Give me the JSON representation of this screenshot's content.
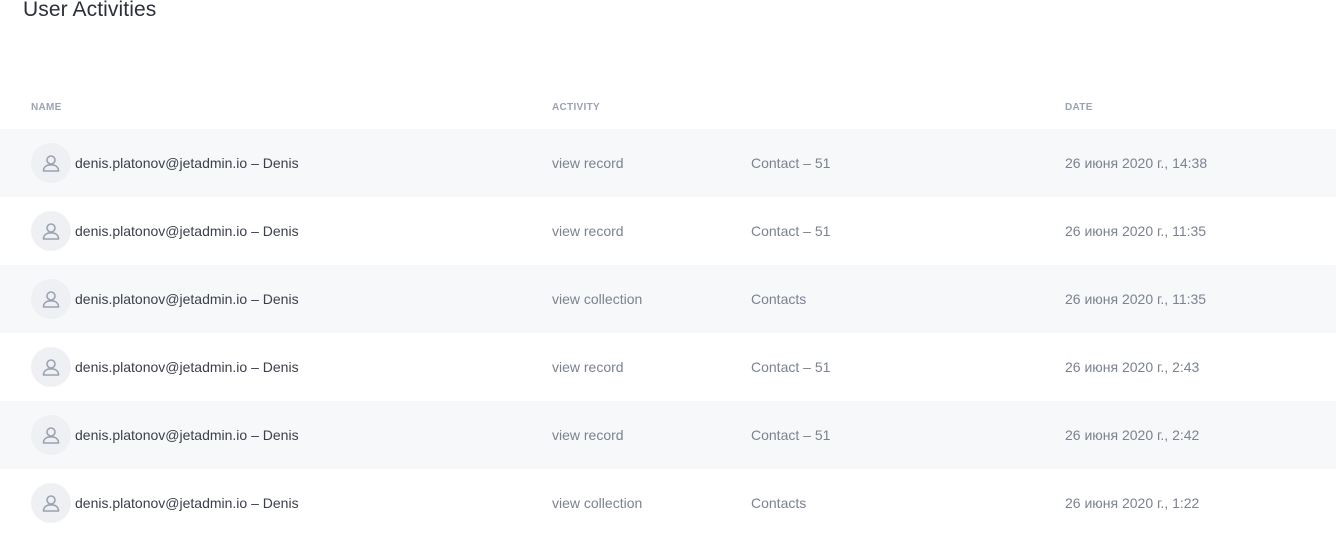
{
  "page": {
    "title": "User Activities"
  },
  "table": {
    "headers": {
      "name": "NAME",
      "activity": "ACTIVITY",
      "date": "DATE"
    },
    "rows": [
      {
        "user": "denis.platonov@jetadmin.io – Denis",
        "activity": "view record",
        "object": "Contact – 51",
        "date": "26 июня 2020 г., 14:38"
      },
      {
        "user": "denis.platonov@jetadmin.io – Denis",
        "activity": "view record",
        "object": "Contact – 51",
        "date": "26 июня 2020 г., 11:35"
      },
      {
        "user": "denis.platonov@jetadmin.io – Denis",
        "activity": "view collection",
        "object": "Contacts",
        "date": "26 июня 2020 г., 11:35"
      },
      {
        "user": "denis.platonov@jetadmin.io – Denis",
        "activity": "view record",
        "object": "Contact – 51",
        "date": "26 июня 2020 г., 2:43"
      },
      {
        "user": "denis.platonov@jetadmin.io – Denis",
        "activity": "view record",
        "object": "Contact – 51",
        "date": "26 июня 2020 г., 2:42"
      },
      {
        "user": "denis.platonov@jetadmin.io – Denis",
        "activity": "view collection",
        "object": "Contacts",
        "date": "26 июня 2020 г., 1:22"
      }
    ]
  },
  "icons": {
    "avatar": "user-icon"
  },
  "colors": {
    "title": "#2b303a",
    "header_text": "#9aa2b1",
    "row_alt_bg": "#f7f8fa",
    "muted_text": "#7b8290",
    "avatar_bg": "#eef0f3",
    "avatar_icon": "#9aa2b1"
  }
}
